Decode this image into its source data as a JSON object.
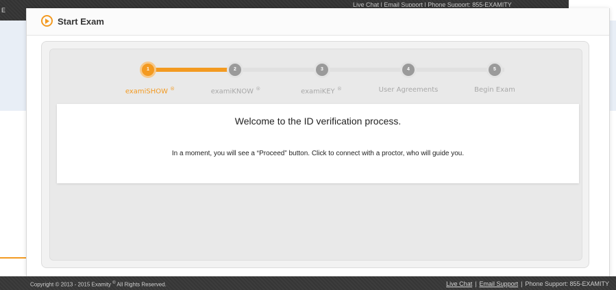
{
  "topbar": {
    "stub_text": "E",
    "links_text": "Live Chat | Email Support | Phone Support: 855-EXAMITY"
  },
  "header": {
    "title": "Start Exam",
    "icon": "play-circle-icon"
  },
  "steps": [
    {
      "number": "1",
      "label": "examiSHOW",
      "reg": "®",
      "active": true
    },
    {
      "number": "2",
      "label": "examiKNOW",
      "reg": "®",
      "active": false
    },
    {
      "number": "3",
      "label": "examiKEY",
      "reg": "®",
      "active": false
    },
    {
      "number": "4",
      "label": "User Agreements",
      "reg": "",
      "active": false
    },
    {
      "number": "5",
      "label": "Begin Exam",
      "reg": "",
      "active": false
    }
  ],
  "content": {
    "welcome": "Welcome to the ID verification process.",
    "instruction": "In a moment, you will see a “Proceed” button. Click to connect with a proctor, who will guide you."
  },
  "footer": {
    "copyright": "Copyright © 2013 - 2015 Examity",
    "reg": "®",
    "rights": " All Rights Reserved.",
    "live_chat": "Live Chat",
    "email_support": "Email Support",
    "phone_support": "Phone Support: 855-EXAMITY",
    "separator": "|"
  },
  "colors": {
    "accent": "#f39a21",
    "footer_bg": "#3a3a3a",
    "inactive_step": "#9a9a9a"
  }
}
